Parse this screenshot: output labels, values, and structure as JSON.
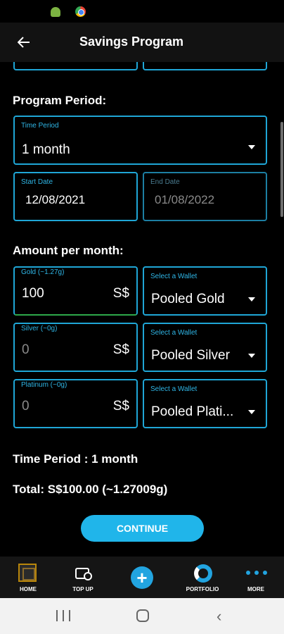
{
  "app_bar": {
    "title": "Savings Program",
    "back_icon": "arrow-left-icon"
  },
  "program_period": {
    "heading": "Program Period:",
    "time_period": {
      "label": "Time Period",
      "value": "1 month"
    },
    "start_date": {
      "label": "Start Date",
      "value": "12/08/2021"
    },
    "end_date": {
      "label": "End Date",
      "value": "01/08/2022"
    }
  },
  "amount_per_month": {
    "heading": "Amount per month:",
    "rows": [
      {
        "label": "Gold (~1.27g)",
        "value": "100",
        "currency": "S$",
        "wallet_label": "Select a Wallet",
        "wallet_value": "Pooled Gold"
      },
      {
        "label": "Silver (~0g)",
        "value": "0",
        "currency": "S$",
        "wallet_label": "Select a Wallet",
        "wallet_value": "Pooled Silver"
      },
      {
        "label": "Platinum (~0g)",
        "value": "0",
        "currency": "S$",
        "wallet_label": "Select a Wallet",
        "wallet_value": "Pooled Plati..."
      }
    ]
  },
  "summary": {
    "time_period": "Time Period : 1 month",
    "total": "Total: S$100.00 (~1.27009g)"
  },
  "continue_label": "CONTINUE",
  "bottom_nav": [
    {
      "label": "HOME",
      "icon": "home-icon"
    },
    {
      "label": "TOP UP",
      "icon": "wallet-topup-icon"
    },
    {
      "label": "",
      "icon": "plus-circle-icon"
    },
    {
      "label": "PORTFOLIO",
      "icon": "portfolio-ring-icon"
    },
    {
      "label": "MORE",
      "icon": "more-dots-icon"
    }
  ],
  "colors": {
    "accent": "#1fa6d6",
    "button": "#20b5ea",
    "focus_underline": "#2ea84a",
    "background": "#000000"
  }
}
